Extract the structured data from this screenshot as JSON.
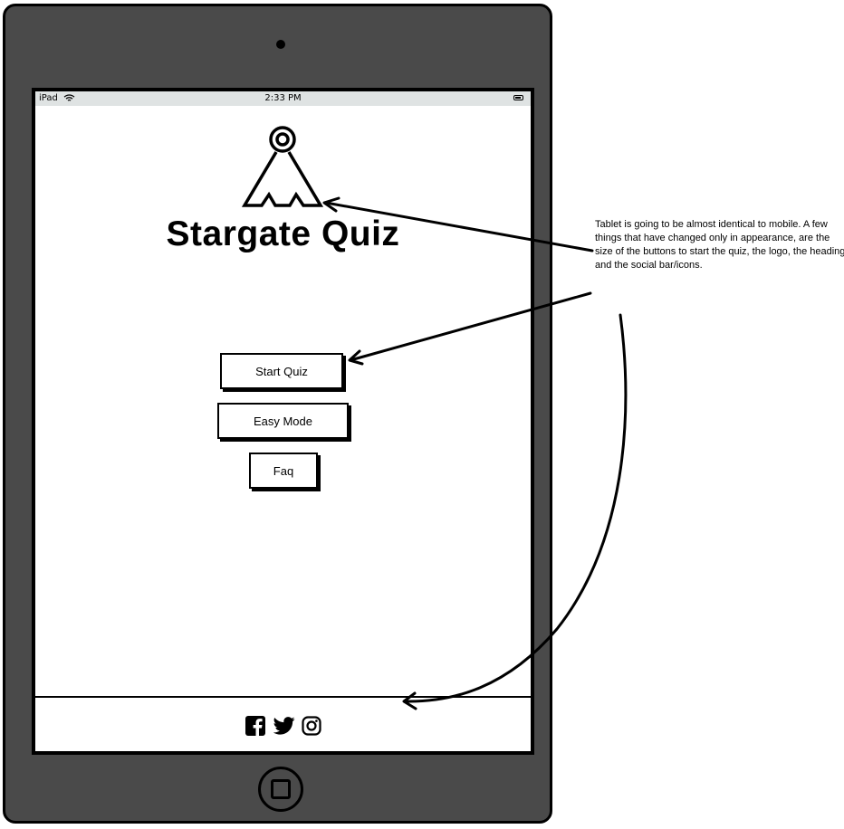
{
  "status_bar": {
    "device": "iPad",
    "time": "2:33 PM",
    "icons": [
      "wifi-icon",
      "battery-icon"
    ]
  },
  "header": {
    "logo_icon": "stargate-logo-icon",
    "title": "Stargate Quiz"
  },
  "buttons": {
    "start_quiz": "Start Quiz",
    "easy_mode": "Easy Mode",
    "faq": "Faq"
  },
  "footer": {
    "social_icons": [
      "facebook-icon",
      "twitter-icon",
      "instagram-icon"
    ]
  },
  "annotation": {
    "text": "Tablet is going to be almost identical to mobile. A few things that have changed only in appearance, are the size of the buttons to start the quiz, the logo, the heading and the social bar/icons."
  },
  "colors": {
    "device_body": "#4a4a4a",
    "status_bar": "#dfe3e3",
    "screen": "#ffffff",
    "ink": "#000000"
  }
}
